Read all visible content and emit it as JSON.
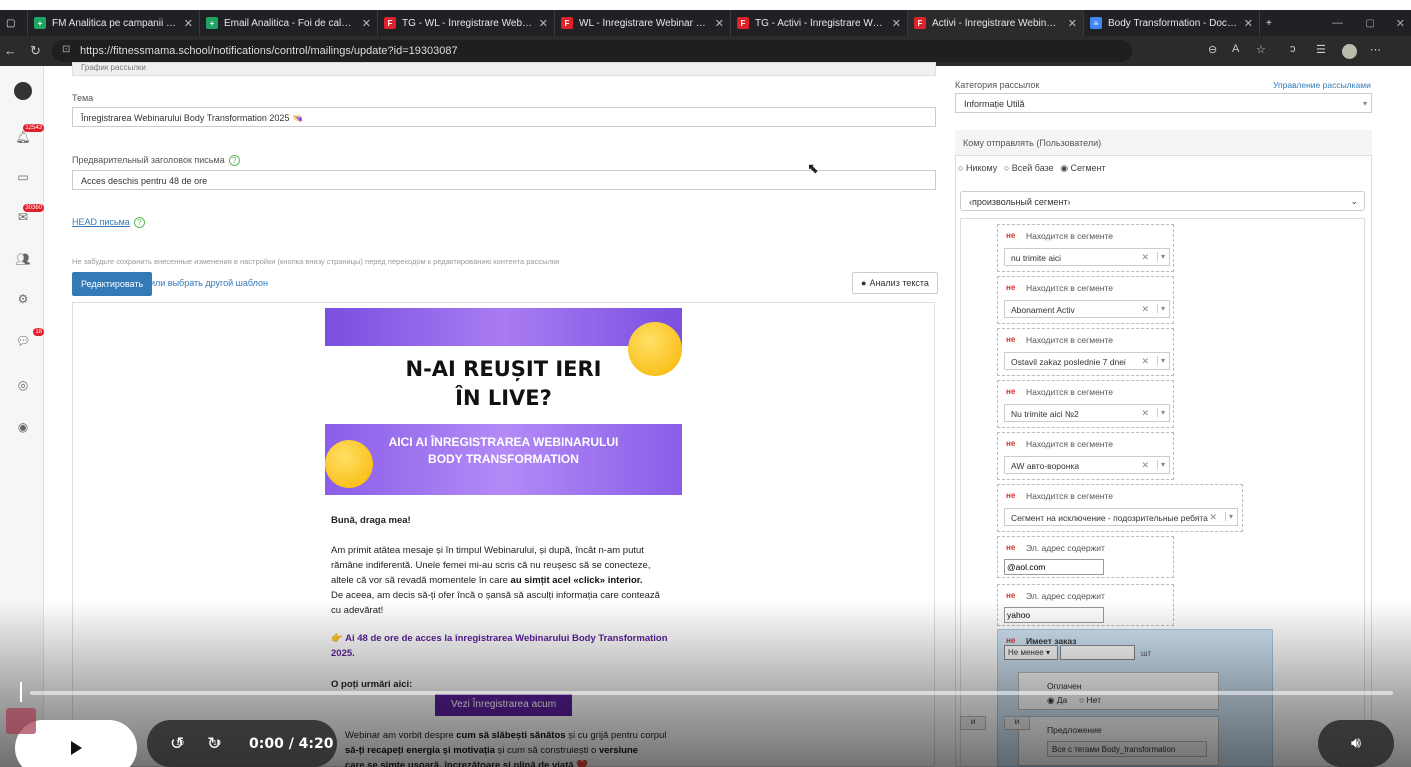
{
  "browser": {
    "tabs": [
      {
        "title": "FM Analitica pe campanii - Foi de",
        "icon": "sheets-icon",
        "color": "#1fa463"
      },
      {
        "title": "Email Analitica - Foi de calcul Go",
        "icon": "sheets-icon",
        "color": "#1fa463"
      },
      {
        "title": "TG - WL - Înregistrare Webinar - I",
        "icon": "fm-icon",
        "color": "#e0202a"
      },
      {
        "title": "WL - Înregistrare Webinar - Body",
        "icon": "fm-icon",
        "color": "#e0202a"
      },
      {
        "title": "TG - Activi - Înregistrare Webinar",
        "icon": "fm-icon",
        "color": "#e0202a"
      },
      {
        "title": "Activi - Înregistrare Webinar - Bo",
        "icon": "fm-icon",
        "color": "#e0202a",
        "active": true
      },
      {
        "title": "Body Transformation - Documen",
        "icon": "docs-icon",
        "color": "#4285f4"
      }
    ],
    "url": "https://fitnessmama.school/notifications/control/mailings/update?id=19303087"
  },
  "sidebar": {
    "badges": [
      "12543",
      "30360",
      "18"
    ]
  },
  "form": {
    "top_crumb": "График рассылки",
    "subject_label": "Тема",
    "subject_value": "Înregistrarea Webinarului Body Transformation 2025 👒",
    "preheader_label": "Предварительный заголовок письма",
    "preheader_value": "Acces deschis pentru 48 de ore",
    "head_link": "HEAD письма",
    "warning": "Не забудьте сохранить внесенные изменения в настройки (кнопка внизу страницы) перед переходом к редактированию контента рассылки",
    "edit_button": "Редактировать",
    "template_link": "или выбрать другой шаблон",
    "analysis_button": "Анализ текста"
  },
  "email": {
    "headline_line1": "N-AI REUȘIT IERI",
    "headline_line2": "ÎN LIVE?",
    "banner_line1": "AICI AI ÎNREGISTRAREA WEBINARULUI",
    "banner_line2": "BODY TRANSFORMATION",
    "greeting": "Bună, draga mea!",
    "p1_a": "Am primit atâtea mesaje și în timpul Webinarului, și după, încât n-am putut",
    "p1_b": "rămâne indiferentă. Unele femei mi-au scris că nu reușesc să se conecteze,",
    "p1_c_pre": "altele că vor să revadă momentele în care ",
    "p1_c_bold": "au simțit acel «click» interior.",
    "p1_d": "De aceea, am decis să-ți ofer încă o șansă să asculți informația care contează",
    "p1_e": "cu adevărat!",
    "p2_a": "👉 Ai 48 de ore de acces la înregistrarea Webinarului Body Transformation",
    "p2_b": "2025.",
    "p3": "O poți urmări aici:",
    "watch_button": "Vezi Înregistrarea acum",
    "p4_a_pre": "Webinar am vorbit despre ",
    "p4_a_bold": "cum să slăbești sănătos",
    "p4_a_post": " și cu grijă pentru corpul",
    "p4_b_bold": "să-ți recapeți energia și motivația",
    "p4_b_post": " și cum să construiești o ",
    "p4_b_bold2": "versiune",
    "p4_c": "care se simte ușoară, încrezătoare și plină de viață ❤️"
  },
  "right": {
    "category_label": "Категория рассылок",
    "manage_link": "Управление рассылками",
    "category_value": "Informație Utilă",
    "send_to_label": "Кому отправлять (Пользователи)",
    "radio_nobody": "Никому",
    "radio_all": "Всей базе",
    "radio_segment": "Сегмент",
    "segment_select": "‹произвольный сегмент›",
    "conditions": [
      {
        "ne": "не",
        "title": "Находится в сегменте",
        "value": "nu trimite aici"
      },
      {
        "ne": "не",
        "title": "Находится в сегменте",
        "value": "Abonament Activ"
      },
      {
        "ne": "не",
        "title": "Находится в сегменте",
        "value": "Ostavil zakaz poslednie 7 dnei"
      },
      {
        "ne": "не",
        "title": "Находится в сегменте",
        "value": "Nu trimite aici №2"
      },
      {
        "ne": "не",
        "title": "Находится в сегменте",
        "value": "AW авто-воронка"
      },
      {
        "ne": "не",
        "title": "Находится в сегменте",
        "value": "Сегмент на исключение - подозрительные ребята"
      },
      {
        "ne": "не",
        "title": "Эл. адрес содержит",
        "value": "@aol.com"
      },
      {
        "ne": "не",
        "title": "Эл. адрес содержит",
        "value": "yahoo"
      }
    ],
    "order": {
      "ne": "не",
      "title": "Имеет заказ",
      "qty_select": "Не менее",
      "unit": "шт",
      "paid_label": "Оплачен",
      "paid_yes": "Да",
      "paid_no": "Нет",
      "offer_label": "Предложение",
      "offer_value": "Все с тегами Body_transformation",
      "and_label": "и"
    }
  },
  "video": {
    "time": "0:00 / 4:20",
    "skip_back": "10",
    "skip_fwd": "10"
  }
}
